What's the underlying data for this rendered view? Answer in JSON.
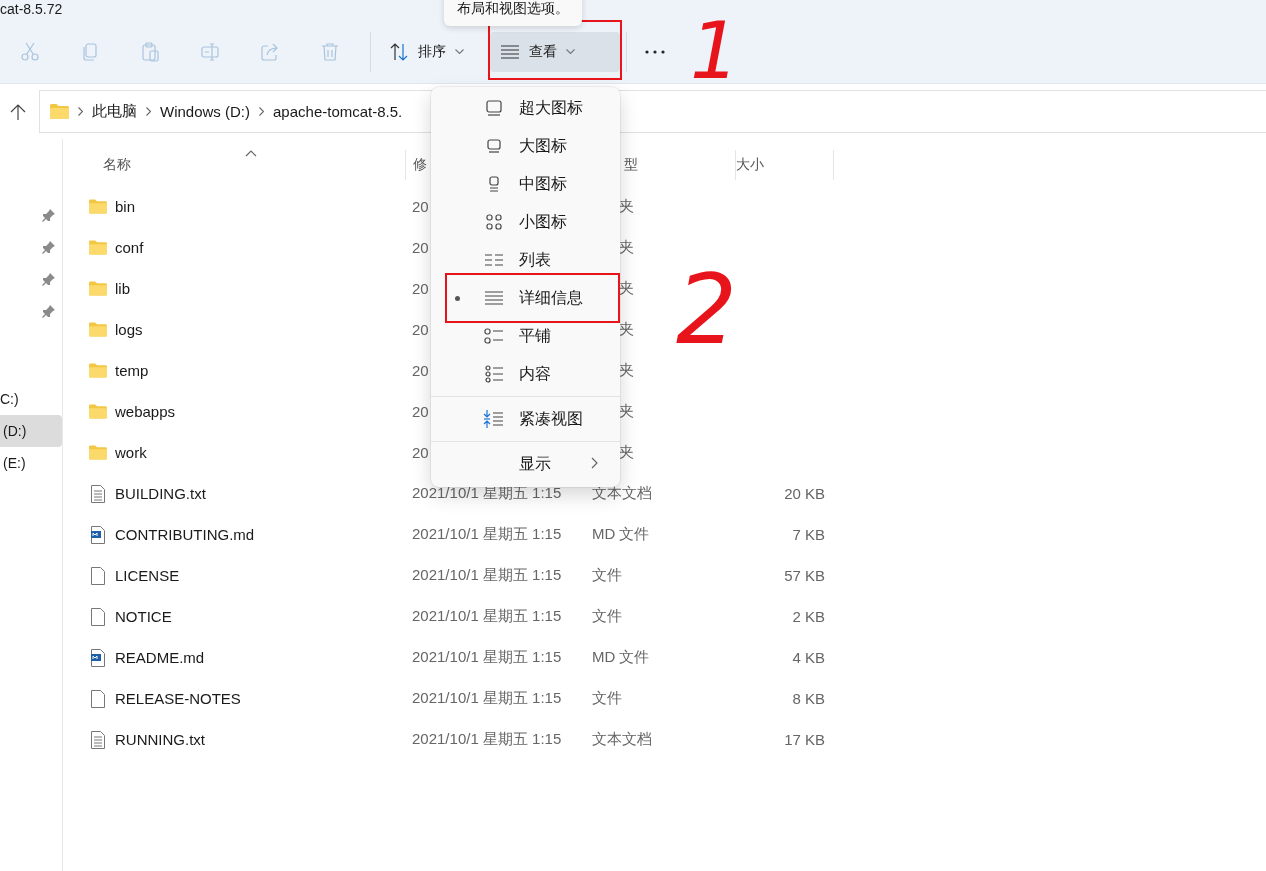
{
  "window": {
    "title": "cat-8.5.72"
  },
  "tooltip": "布局和视图选项。",
  "toolbar": {
    "actions": [
      {
        "kind": "cut",
        "disabled": true
      },
      {
        "kind": "copy",
        "disabled": true
      },
      {
        "kind": "paste",
        "disabled": true
      },
      {
        "kind": "rename",
        "disabled": true
      },
      {
        "kind": "share",
        "disabled": true
      },
      {
        "kind": "delete",
        "disabled": true
      }
    ],
    "sort": {
      "label": "排序"
    },
    "view": {
      "label": "查看",
      "selected": true,
      "highlighted": true
    }
  },
  "address": {
    "path": [
      "此电脑",
      "Windows (D:)",
      "apache-tomcat-8.5."
    ]
  },
  "nav": {
    "drives": [
      {
        "label": "C:)",
        "selected": false
      },
      {
        "label": "(D:)",
        "selected": true
      },
      {
        "label": "(E:)",
        "selected": false
      }
    ]
  },
  "table": {
    "columns": [
      {
        "label": "名称",
        "sorted": true
      },
      {
        "label": "修",
        "sorted": false
      },
      {
        "label": "型",
        "sorted": false
      },
      {
        "label": "大小",
        "sorted": false
      }
    ],
    "rows": [
      {
        "name": "bin",
        "kind": "folder",
        "date": "20",
        "type": "夹",
        "under_menu": true
      },
      {
        "name": "conf",
        "kind": "folder",
        "date": "20",
        "type": "夹",
        "under_menu": true
      },
      {
        "name": "lib",
        "kind": "folder",
        "date": "20",
        "type": "夹",
        "under_menu": true
      },
      {
        "name": "logs",
        "kind": "folder",
        "date": "20",
        "type": "夹",
        "under_menu": true
      },
      {
        "name": "temp",
        "kind": "folder",
        "date": "20",
        "type": "夹",
        "under_menu": true
      },
      {
        "name": "webapps",
        "kind": "folder",
        "date": "20",
        "type": "夹",
        "under_menu": true
      },
      {
        "name": "work",
        "kind": "folder",
        "date": "20",
        "type": "夹",
        "under_menu": true
      },
      {
        "name": "BUILDING.txt",
        "kind": "text",
        "date": "2021/10/1 星期五 1:15",
        "type": "文本文档",
        "size": "20 KB",
        "under_menu": false
      },
      {
        "name": "CONTRIBUTING.md",
        "kind": "markdown",
        "date": "2021/10/1 星期五 1:15",
        "type": "MD 文件",
        "size": "7 KB",
        "under_menu": false
      },
      {
        "name": "LICENSE",
        "kind": "file",
        "date": "2021/10/1 星期五 1:15",
        "type": "文件",
        "size": "57 KB",
        "under_menu": false
      },
      {
        "name": "NOTICE",
        "kind": "file",
        "date": "2021/10/1 星期五 1:15",
        "type": "文件",
        "size": "2 KB",
        "under_menu": false
      },
      {
        "name": "README.md",
        "kind": "markdown",
        "date": "2021/10/1 星期五 1:15",
        "type": "MD 文件",
        "size": "4 KB",
        "under_menu": false
      },
      {
        "name": "RELEASE-NOTES",
        "kind": "file",
        "date": "2021/10/1 星期五 1:15",
        "type": "文件",
        "size": "8 KB",
        "under_menu": false
      },
      {
        "name": "RUNNING.txt",
        "kind": "text",
        "date": "2021/10/1 星期五 1:15",
        "type": "文本文档",
        "size": "17 KB",
        "under_menu": false
      }
    ]
  },
  "view_menu": {
    "items": [
      {
        "kind": "extra-large",
        "label": "超大图标",
        "selected": false,
        "highlighted": false
      },
      {
        "kind": "large",
        "label": "大图标",
        "selected": false,
        "highlighted": false
      },
      {
        "kind": "medium",
        "label": "中图标",
        "selected": false,
        "highlighted": false
      },
      {
        "kind": "small",
        "label": "小图标",
        "selected": false,
        "highlighted": false
      },
      {
        "kind": "list",
        "label": "列表",
        "selected": false,
        "highlighted": false
      },
      {
        "kind": "details",
        "label": "详细信息",
        "selected": true,
        "highlighted": true
      },
      {
        "kind": "tiles",
        "label": "平铺",
        "selected": false,
        "highlighted": false
      },
      {
        "kind": "content",
        "label": "内容",
        "selected": false,
        "highlighted": false
      },
      {
        "kind": "separator"
      },
      {
        "kind": "compact",
        "label": "紧凑视图",
        "selected": false,
        "highlighted": false
      },
      {
        "kind": "separator"
      },
      {
        "kind": "submenu",
        "label": "显示",
        "selected": false,
        "highlighted": false
      }
    ]
  },
  "annotations": [
    {
      "label": "1"
    },
    {
      "label": "2"
    }
  ]
}
